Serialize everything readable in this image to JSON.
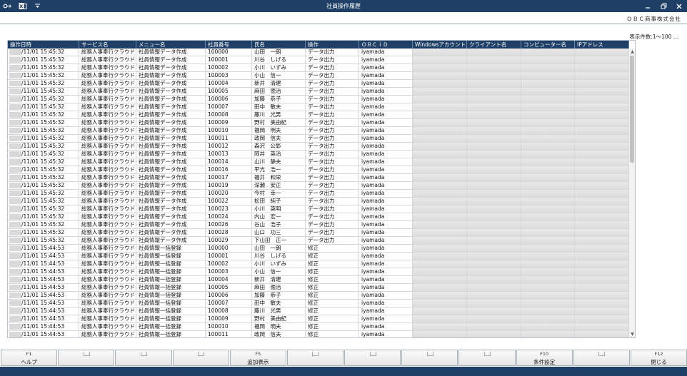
{
  "window": {
    "title": "社員操作履歴",
    "icons": [
      "key-plus-icon",
      "excel-icon",
      "dropdown-arrow-icon"
    ],
    "controls": [
      "minimize",
      "restore",
      "close"
    ]
  },
  "company": {
    "name": "ＯＢＣ商事株式会社"
  },
  "record_count": "表示件数:1〜100 ...",
  "columns": [
    "操作日時",
    "サービス名",
    "メニュー名",
    "社員番号",
    "氏名",
    "操作",
    "ＯＢＣｉＤ",
    "Windowsアカウント",
    "クライアント名",
    "コンピューター名",
    "IPアドレス"
  ],
  "rows": [
    [
      "/11/01 15:45:32",
      "総務人事奉行クラウド",
      "社員情報データ作成",
      "100000",
      "山田　一朗",
      "データ出力",
      "iyamada"
    ],
    [
      "/11/01 15:45:32",
      "総務人事奉行クラウド",
      "社員情報データ作成",
      "100001",
      "川谷　しげる",
      "データ出力",
      "iyamada"
    ],
    [
      "/11/01 15:45:32",
      "総務人事奉行クラウド",
      "社員情報データ作成",
      "100002",
      "小川　いずみ",
      "データ出力",
      "iyamada"
    ],
    [
      "/11/01 15:45:32",
      "総務人事奉行クラウド",
      "社員情報データ作成",
      "100003",
      "小山　信一",
      "データ出力",
      "iyamada"
    ],
    [
      "/11/01 15:45:32",
      "総務人事奉行クラウド",
      "社員情報データ作成",
      "100004",
      "新井　清建",
      "データ出力",
      "iyamada"
    ],
    [
      "/11/01 15:45:32",
      "総務人事奉行クラウド",
      "社員情報データ作成",
      "100005",
      "麻田　徳治",
      "データ出力",
      "iyamada"
    ],
    [
      "/11/01 15:45:32",
      "総務人事奉行クラウド",
      "社員情報データ作成",
      "100006",
      "加藤　恭子",
      "データ出力",
      "iyamada"
    ],
    [
      "/11/01 15:45:32",
      "総務人事奉行クラウド",
      "社員情報データ作成",
      "100007",
      "田中　敏夫",
      "データ出力",
      "iyamada"
    ],
    [
      "/11/01 15:45:32",
      "総務人事奉行クラウド",
      "社員情報データ作成",
      "100008",
      "藤川　光男",
      "データ出力",
      "iyamada"
    ],
    [
      "/11/01 15:45:32",
      "総務人事奉行クラウド",
      "社員情報データ作成",
      "100009",
      "野村　美由紀",
      "データ出力",
      "iyamada"
    ],
    [
      "/11/01 15:45:32",
      "総務人事奉行クラウド",
      "社員情報データ作成",
      "100010",
      "福岡　明夫",
      "データ出力",
      "iyamada"
    ],
    [
      "/11/01 15:45:32",
      "総務人事奉行クラウド",
      "社員情報データ作成",
      "100011",
      "政岡　信夫",
      "データ出力",
      "iyamada"
    ],
    [
      "/11/01 15:45:32",
      "総務人事奉行クラウド",
      "社員情報データ作成",
      "100012",
      "森沢　公彰",
      "データ出力",
      "iyamada"
    ],
    [
      "/11/01 15:45:32",
      "総務人事奉行クラウド",
      "社員情報データ作成",
      "100013",
      "岡井　英治",
      "データ出力",
      "iyamada"
    ],
    [
      "/11/01 15:45:32",
      "総務人事奉行クラウド",
      "社員情報データ作成",
      "100014",
      "山川　静夫",
      "データ出力",
      "iyamada"
    ],
    [
      "/11/01 15:45:32",
      "総務人事奉行クラウド",
      "社員情報データ作成",
      "100016",
      "平光　浩一",
      "データ出力",
      "iyamada"
    ],
    [
      "/11/01 15:45:32",
      "総務人事奉行クラウド",
      "社員情報データ作成",
      "100017",
      "福井　和栄",
      "データ出力",
      "iyamada"
    ],
    [
      "/11/01 15:45:32",
      "総務人事奉行クラウド",
      "社員情報データ作成",
      "100019",
      "深瀬　安正",
      "データ出力",
      "iyamada"
    ],
    [
      "/11/01 15:45:32",
      "総務人事奉行クラウド",
      "社員情報データ作成",
      "100020",
      "今村　幸一",
      "データ出力",
      "iyamada"
    ],
    [
      "/11/01 15:45:32",
      "総務人事奉行クラウド",
      "社員情報データ作成",
      "100022",
      "松田　純子",
      "データ出力",
      "iyamada"
    ],
    [
      "/11/01 15:45:32",
      "総務人事奉行クラウド",
      "社員情報データ作成",
      "100023",
      "小川　英明",
      "データ出力",
      "iyamada"
    ],
    [
      "/11/01 15:45:32",
      "総務人事奉行クラウド",
      "社員情報データ作成",
      "100024",
      "内山　宏一",
      "データ出力",
      "iyamada"
    ],
    [
      "/11/01 15:45:32",
      "総務人事奉行クラウド",
      "社員情報データ作成",
      "100026",
      "谷山　浩子",
      "データ出力",
      "iyamada"
    ],
    [
      "/11/01 15:45:32",
      "総務人事奉行クラウド",
      "社員情報データ作成",
      "100028",
      "山口　功三",
      "データ出力",
      "iyamada"
    ],
    [
      "/11/01 15:45:32",
      "総務人事奉行クラウド",
      "社員情報データ作成",
      "100029",
      "下山田　正一",
      "データ出力",
      "iyamada"
    ],
    [
      "/11/01 15:44:53",
      "総務人事奉行クラウド",
      "社員情報一括登録",
      "100000",
      "山田　一朗",
      "修正",
      "iyamada"
    ],
    [
      "/11/01 15:44:53",
      "総務人事奉行クラウド",
      "社員情報一括登録",
      "100001",
      "川谷　しげる",
      "修正",
      "iyamada"
    ],
    [
      "/11/01 15:44:53",
      "総務人事奉行クラウド",
      "社員情報一括登録",
      "100002",
      "小川　いずみ",
      "修正",
      "iyamada"
    ],
    [
      "/11/01 15:44:53",
      "総務人事奉行クラウド",
      "社員情報一括登録",
      "100003",
      "小山　信一",
      "修正",
      "iyamada"
    ],
    [
      "/11/01 15:44:53",
      "総務人事奉行クラウド",
      "社員情報一括登録",
      "100004",
      "新井　清建",
      "修正",
      "iyamada"
    ],
    [
      "/11/01 15:44:53",
      "総務人事奉行クラウド",
      "社員情報一括登録",
      "100005",
      "麻田　徳治",
      "修正",
      "iyamada"
    ],
    [
      "/11/01 15:44:53",
      "総務人事奉行クラウド",
      "社員情報一括登録",
      "100006",
      "加藤　恭子",
      "修正",
      "iyamada"
    ],
    [
      "/11/01 15:44:53",
      "総務人事奉行クラウド",
      "社員情報一括登録",
      "100007",
      "田中　敏夫",
      "修正",
      "iyamada"
    ],
    [
      "/11/01 15:44:53",
      "総務人事奉行クラウド",
      "社員情報一括登録",
      "100008",
      "藤川　光男",
      "修正",
      "iyamada"
    ],
    [
      "/11/01 15:44:53",
      "総務人事奉行クラウド",
      "社員情報一括登録",
      "100009",
      "野村　美由紀",
      "修正",
      "iyamada"
    ],
    [
      "/11/01 15:44:53",
      "総務人事奉行クラウド",
      "社員情報一括登録",
      "100010",
      "福岡　明夫",
      "修正",
      "iyamada"
    ],
    [
      "/11/01 15:44:53",
      "総務人事奉行クラウド",
      "社員情報一括登録",
      "100011",
      "政岡　信夫",
      "修正",
      "iyamada"
    ]
  ],
  "function_keys": [
    {
      "key": "F1",
      "label": "ヘルプ"
    },
    {
      "key": "",
      "label": ""
    },
    {
      "key": "",
      "label": ""
    },
    {
      "key": "",
      "label": ""
    },
    {
      "key": "F5",
      "label": "追加表示"
    },
    {
      "key": "",
      "label": ""
    },
    {
      "key": "",
      "label": ""
    },
    {
      "key": "",
      "label": ""
    },
    {
      "key": "",
      "label": ""
    },
    {
      "key": "F10",
      "label": "条件設定"
    },
    {
      "key": "",
      "label": ""
    },
    {
      "key": "F12",
      "label": "閉じる"
    }
  ],
  "colors": {
    "titlebar": "#1f3f66",
    "header": "#1f3f66",
    "accent": "#1f3f66"
  }
}
